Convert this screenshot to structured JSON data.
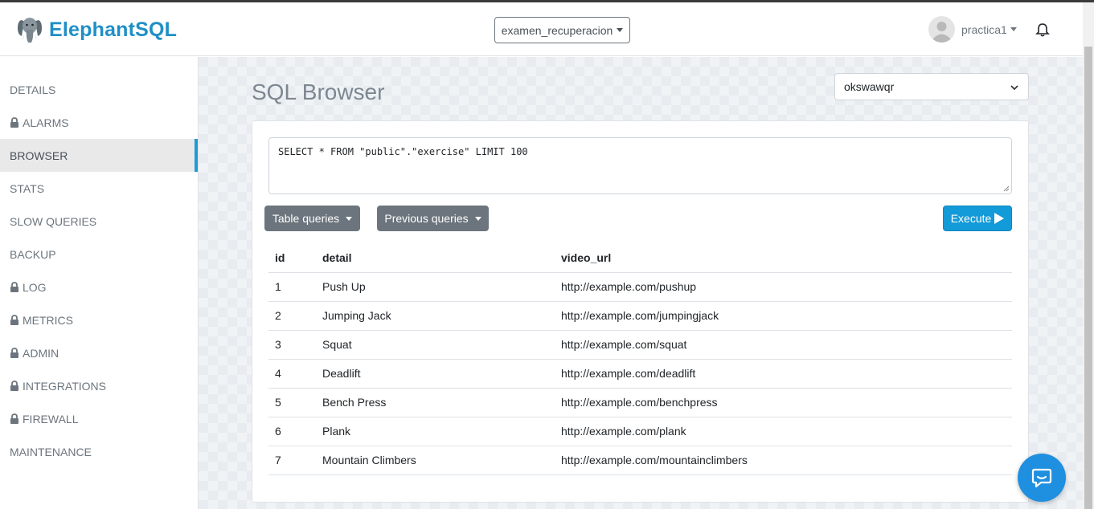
{
  "header": {
    "brand": "ElephantSQL",
    "instance": "examen_recuperacion",
    "username": "practica1"
  },
  "sidebar": {
    "items": [
      {
        "label": "DETAILS",
        "locked": false
      },
      {
        "label": "ALARMS",
        "locked": true
      },
      {
        "label": "BROWSER",
        "locked": false,
        "active": true
      },
      {
        "label": "STATS",
        "locked": false
      },
      {
        "label": "SLOW QUERIES",
        "locked": false
      },
      {
        "label": "BACKUP",
        "locked": false
      },
      {
        "label": "LOG",
        "locked": true
      },
      {
        "label": "METRICS",
        "locked": true
      },
      {
        "label": "ADMIN",
        "locked": true
      },
      {
        "label": "INTEGRATIONS",
        "locked": true
      },
      {
        "label": "FIREWALL",
        "locked": true
      },
      {
        "label": "MAINTENANCE",
        "locked": false
      }
    ]
  },
  "main": {
    "title": "SQL Browser",
    "database": "okswawqr",
    "query": "SELECT * FROM \"public\".\"exercise\" LIMIT 100",
    "table_queries_label": "Table queries",
    "previous_queries_label": "Previous queries",
    "execute_label": "Execute"
  },
  "results": {
    "columns": [
      "id",
      "detail",
      "video_url"
    ],
    "rows": [
      [
        "1",
        "Push Up",
        "http://example.com/pushup"
      ],
      [
        "2",
        "Jumping Jack",
        "http://example.com/jumpingjack"
      ],
      [
        "3",
        "Squat",
        "http://example.com/squat"
      ],
      [
        "4",
        "Deadlift",
        "http://example.com/deadlift"
      ],
      [
        "5",
        "Bench Press",
        "http://example.com/benchpress"
      ],
      [
        "6",
        "Plank",
        "http://example.com/plank"
      ],
      [
        "7",
        "Mountain Climbers",
        "http://example.com/mountainclimbers"
      ]
    ]
  },
  "colors": {
    "brand": "#1f8fc6",
    "primary_button": "#139ad8",
    "secondary_button": "#6c757d",
    "active_indicator": "#1f9bd6",
    "chat_widget": "#1f8fe0"
  },
  "icons": [
    "elephant-logo-icon",
    "caret-down-icon",
    "user-avatar-icon",
    "bell-icon",
    "lock-icon",
    "chevron-down-icon",
    "play-icon",
    "chat-icon"
  ]
}
